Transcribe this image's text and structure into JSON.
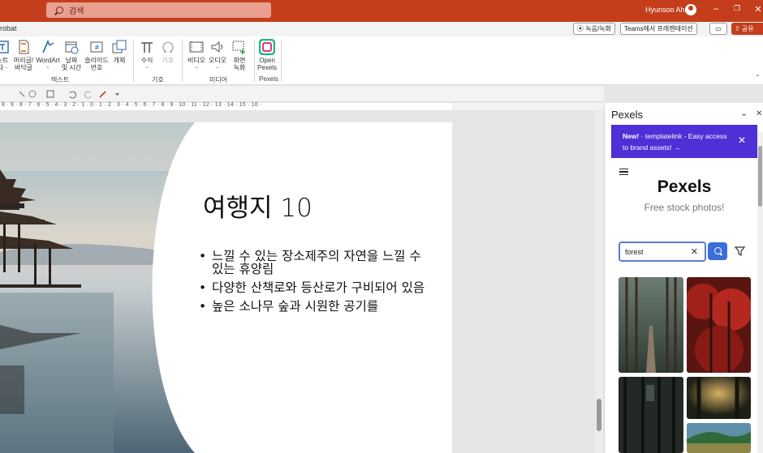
{
  "titlebar": {
    "search_placeholder": "검색",
    "user_name": "Hyunsoo Ahn",
    "minimize": "–",
    "restore": "❐",
    "close": "✕"
  },
  "tabsrow": {
    "label": "robat",
    "record_button": "⦿ 녹음/녹화",
    "teams_button": "Teams에서 프레젠테이션",
    "comment_icon": "comment-icon",
    "share_button": "⇪ 공유"
  },
  "ribbon": {
    "buttons": [
      {
        "label": "스트\n자 ·",
        "icon": "textbox-icon"
      },
      {
        "label": "머리글/\n바닥글",
        "icon": "header-footer-icon"
      },
      {
        "label": "WordArt",
        "icon": "wordart-icon"
      },
      {
        "label": "날짜\n및 시간",
        "icon": "date-time-icon"
      },
      {
        "label": "슬라이드\n번호",
        "icon": "slide-number-icon"
      },
      {
        "label": "개체",
        "icon": "object-icon"
      },
      {
        "label": "수식",
        "icon": "equation-icon"
      },
      {
        "label": "기호",
        "icon": "symbol-icon"
      },
      {
        "label": "비디오",
        "icon": "video-icon"
      },
      {
        "label": "오디오",
        "icon": "audio-icon"
      },
      {
        "label": "화면\n녹화",
        "icon": "screen-recording-icon"
      },
      {
        "label": "Open\nPexels",
        "icon": "pexels-icon"
      }
    ],
    "groups": [
      "텍스트",
      "기호",
      "미디어",
      "Pexels"
    ]
  },
  "ruler": {
    "ticks": "8 · 9 · 8 · 7 · 6 · 5 · 4 · 3 · 2 · 1 · 0 · 1 · 2 · 3 · 4 · 5 · 6 · 7 · 8 · 9 · 10 · 11 · 12 · 13 · 14 · 15 · 16 ·"
  },
  "slide": {
    "title": "여행지 10",
    "bullets": [
      "느낄 수 있는 장소제주의 자연을 느낄 수 있는 휴양림",
      "다양한 산책로와 등산로가 구비되어 있음",
      "높은 소나무 숲과 시원한 공기를"
    ]
  },
  "pane": {
    "title": "Pexels",
    "collapse": "⌄",
    "close": "✕",
    "banner_new": "New!",
    "banner_text": "· templatelink - Easy access to brand assets! →",
    "banner_close": "✕",
    "brand": "Pexels",
    "tagline": "Free stock photos!",
    "search_value": "forest",
    "search_clear": "✕",
    "filter_icon": "filter-icon"
  }
}
